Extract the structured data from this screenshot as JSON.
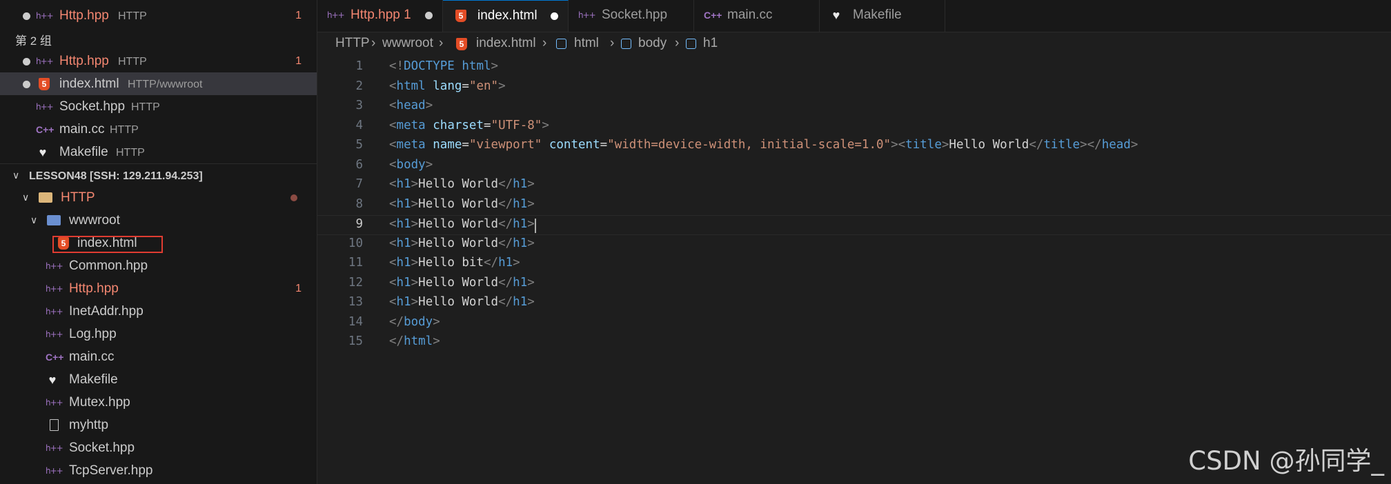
{
  "sidebar": {
    "editors_group1": [
      {
        "name": "Http.hpp",
        "desc": "HTTP",
        "badge": "1",
        "icon": "cpp-header-icon"
      }
    ],
    "group2_label": "第 2 组",
    "editors_group2": [
      {
        "name": "Http.hpp",
        "desc": "HTTP",
        "badge": "1",
        "icon": "cpp-header-icon"
      },
      {
        "name": "index.html",
        "desc": "HTTP/wwwroot",
        "icon": "html5-icon"
      },
      {
        "name": "Socket.hpp",
        "desc": "HTTP",
        "icon": "cpp-header-icon"
      },
      {
        "name": "main.cc",
        "desc": "HTTP",
        "icon": "cpp-icon"
      },
      {
        "name": "Makefile",
        "desc": "HTTP",
        "icon": "makefile-icon"
      }
    ],
    "explorer_title": "LESSON48 [SSH: 129.211.94.253]",
    "tree": {
      "root_folder": "HTTP",
      "subfolder": "wwwroot",
      "subfolder_file": "index.html",
      "files": [
        {
          "name": "Common.hpp",
          "icon": "cpp-header-icon"
        },
        {
          "name": "Http.hpp",
          "icon": "cpp-header-icon",
          "badge": "1"
        },
        {
          "name": "InetAddr.hpp",
          "icon": "cpp-header-icon"
        },
        {
          "name": "Log.hpp",
          "icon": "cpp-header-icon"
        },
        {
          "name": "main.cc",
          "icon": "cpp-icon"
        },
        {
          "name": "Makefile",
          "icon": "makefile-icon"
        },
        {
          "name": "Mutex.hpp",
          "icon": "cpp-header-icon"
        },
        {
          "name": "myhttp",
          "icon": "file-icon"
        },
        {
          "name": "Socket.hpp",
          "icon": "cpp-header-icon"
        },
        {
          "name": "TcpServer.hpp",
          "icon": "cpp-header-icon"
        }
      ]
    }
  },
  "tabs": [
    {
      "label": "Http.hpp 1",
      "icon": "cpp-header-icon",
      "modified": true
    },
    {
      "label": "index.html",
      "icon": "html5-icon",
      "active": true,
      "dirty": true
    },
    {
      "label": "Socket.hpp",
      "icon": "cpp-header-icon"
    },
    {
      "label": "main.cc",
      "icon": "cpp-icon"
    },
    {
      "label": "Makefile",
      "icon": "makefile-icon"
    }
  ],
  "breadcrumb": [
    "HTTP",
    "wwwroot",
    "index.html",
    "html",
    "body",
    "h1"
  ],
  "editor": {
    "current_line": 9,
    "line_numbers": [
      "1",
      "2",
      "3",
      "4",
      "5",
      "6",
      "7",
      "8",
      "9",
      "10",
      "11",
      "12",
      "13",
      "14",
      "15"
    ],
    "lines": [
      "<!DOCTYPE html>",
      "<html lang=\"en\">",
      "<head>",
      "<meta charset=\"UTF-8\">",
      "<meta name=\"viewport\" content=\"width=device-width, initial-scale=1.0\"><title>Hello World</title></head>",
      "<body>",
      "<h1>Hello World</h1>",
      "<h1>Hello World</h1>",
      "<h1>Hello World</h1>",
      "<h1>Hello World</h1>",
      "<h1>Hello bit</h1>",
      "<h1>Hello World</h1>",
      "<h1>Hello World</h1>",
      "</body>",
      "</html>"
    ]
  },
  "watermark": "CSDN @孙同学_",
  "colors": {
    "modified": "#f48771",
    "html5": "#e44d26",
    "accent": "#0078d4",
    "tag": "#569cd6",
    "attr": "#9cdcfe",
    "string": "#ce9178"
  }
}
